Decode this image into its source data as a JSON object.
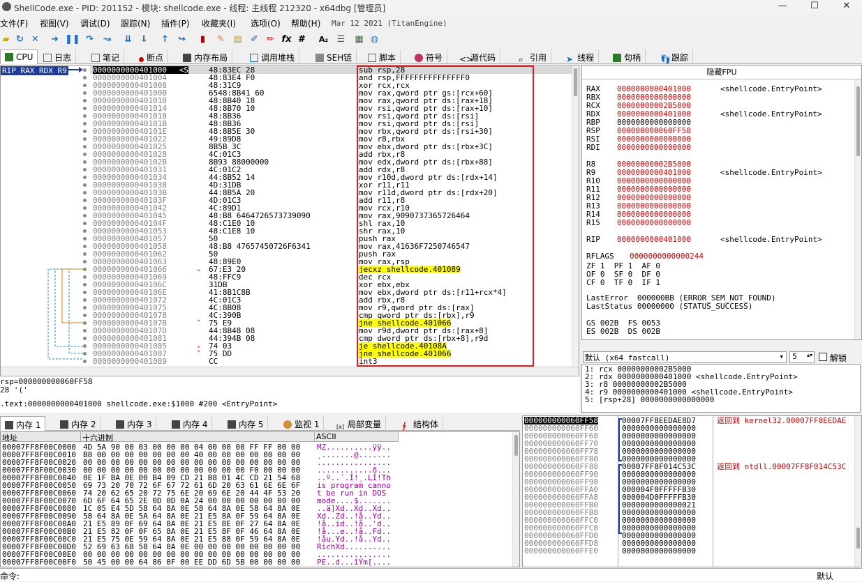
{
  "title": "ShellCode.exe - PID: 201152 - 模块: shellcode.exe - 线程: 主线程 212320 - x64dbg [管理员]",
  "window_controls": [
    "—",
    "☐",
    "✕"
  ],
  "menus": [
    "文件(F)",
    "视图(V)",
    "调试(D)",
    "跟踪(N)",
    "插件(P)",
    "收藏夹(I)",
    "选项(O)",
    "帮助(H)"
  ],
  "build_info": "Mar 12 2021 (TitanEngine)",
  "toolbar_icons": [
    "open-icon",
    "restart-icon",
    "close-icon",
    "run-icon",
    "pause-icon",
    "step-into-icon",
    "step-over-icon",
    "trace-into-icon",
    "trace-over-icon",
    "execute-till-return-icon",
    "run-to-user-code-icon",
    "bookmark-icon",
    "comment-icon",
    "label-icon",
    "patch-icon",
    "highlight-icon",
    "function-icon",
    "hash-icon",
    "font-icon",
    "list-icon",
    "calculator-icon",
    "globe-icon"
  ],
  "tabs": [
    {
      "label": "CPU",
      "icon": "cpu-icon",
      "active": true
    },
    {
      "label": "日志",
      "icon": "log-icon"
    },
    {
      "label": "笔记",
      "icon": "notes-icon"
    },
    {
      "label": "断点",
      "icon": "breakpoint-icon"
    },
    {
      "label": "内存布局",
      "icon": "memory-map-icon"
    },
    {
      "label": "调用堆栈",
      "icon": "callstack-icon"
    },
    {
      "label": "SEH链",
      "icon": "seh-icon"
    },
    {
      "label": "脚本",
      "icon": "script-icon"
    },
    {
      "label": "符号",
      "icon": "symbols-icon"
    },
    {
      "label": "源代码",
      "icon": "source-icon"
    },
    {
      "label": "引用",
      "icon": "references-icon"
    },
    {
      "label": "线程",
      "icon": "threads-icon"
    },
    {
      "label": "句柄",
      "icon": "handles-icon"
    },
    {
      "label": "跟踪",
      "icon": "trace-icon"
    }
  ],
  "reg_tag": "RIP RAX RDX R9",
  "disasm": [
    {
      "addr": "0000000000401000",
      "bytes": "48:83EC 28",
      "instr": "sub rsp,28",
      "selected": true,
      "addr_suffix": " <S"
    },
    {
      "addr": "0000000000401004",
      "bytes": "48:83E4 F0",
      "instr": "and rsp,FFFFFFFFFFFFFFF0"
    },
    {
      "addr": "0000000000401008",
      "bytes": "48:31C9",
      "instr": "xor rcx,rcx"
    },
    {
      "addr": "000000000040100B",
      "bytes": "6548:8B41 60",
      "instr": "mov rax,qword ptr gs:[rcx+60]"
    },
    {
      "addr": "0000000000401010",
      "bytes": "48:8B40 18",
      "instr": "mov rax,qword ptr ds:[rax+18]"
    },
    {
      "addr": "0000000000401014",
      "bytes": "48:8B70 10",
      "instr": "mov rsi,qword ptr ds:[rax+10]"
    },
    {
      "addr": "0000000000401018",
      "bytes": "48:8B36",
      "instr": "mov rsi,qword ptr ds:[rsi]"
    },
    {
      "addr": "000000000040101B",
      "bytes": "48:8B36",
      "instr": "mov rsi,qword ptr ds:[rsi]"
    },
    {
      "addr": "000000000040101E",
      "bytes": "48:8B5E 30",
      "instr": "mov rbx,qword ptr ds:[rsi+30]"
    },
    {
      "addr": "0000000000401022",
      "bytes": "49:89D8",
      "instr": "mov r8,rbx"
    },
    {
      "addr": "0000000000401025",
      "bytes": "8B5B 3C",
      "instr": "mov ebx,dword ptr ds:[rbx+3C]"
    },
    {
      "addr": "0000000000401028",
      "bytes": "4C:01C3",
      "instr": "add rbx,r8"
    },
    {
      "addr": "000000000040102B",
      "bytes": "8B93 88000000",
      "instr": "mov edx,dword ptr ds:[rbx+88]"
    },
    {
      "addr": "0000000000401031",
      "bytes": "4C:01C2",
      "instr": "add rdx,r8"
    },
    {
      "addr": "0000000000401034",
      "bytes": "44:8B52 14",
      "instr": "mov r10d,dword ptr ds:[rdx+14]"
    },
    {
      "addr": "0000000000401038",
      "bytes": "4D:31DB",
      "instr": "xor r11,r11"
    },
    {
      "addr": "000000000040103B",
      "bytes": "44:8B5A 20",
      "instr": "mov r11d,dword ptr ds:[rdx+20]"
    },
    {
      "addr": "000000000040103F",
      "bytes": "4D:01C3",
      "instr": "add r11,r8"
    },
    {
      "addr": "0000000000401042",
      "bytes": "4C:89D1",
      "instr": "mov rcx,r10"
    },
    {
      "addr": "0000000000401045",
      "bytes": "48:B8 6464726573739090",
      "instr": "mov rax,9090737365726464"
    },
    {
      "addr": "000000000040104F",
      "bytes": "48:C1E0 10",
      "instr": "shl rax,10"
    },
    {
      "addr": "0000000000401053",
      "bytes": "48:C1E8 10",
      "instr": "shr rax,10"
    },
    {
      "addr": "0000000000401057",
      "bytes": "50",
      "instr": "push rax"
    },
    {
      "addr": "0000000000401058",
      "bytes": "48:B8 47657450726F6341",
      "instr": "mov rax,41636F7250746547"
    },
    {
      "addr": "0000000000401062",
      "bytes": "50",
      "instr": "push rax"
    },
    {
      "addr": "0000000000401063",
      "bytes": "48:89E0",
      "instr": "mov rax,rsp"
    },
    {
      "addr": "0000000000401066",
      "bytes": "67:E3 20",
      "instr": "jecxz shellcode.401089",
      "jump": true,
      "arrow": "v"
    },
    {
      "addr": "0000000000401069",
      "bytes": "48:FFC9",
      "instr": "dec rcx"
    },
    {
      "addr": "000000000040106C",
      "bytes": "31DB",
      "instr": "xor ebx,ebx"
    },
    {
      "addr": "000000000040106E",
      "bytes": "41:8B1C8B",
      "instr": "mov ebx,dword ptr ds:[r11+rcx*4]"
    },
    {
      "addr": "0000000000401072",
      "bytes": "4C:01C3",
      "instr": "add rbx,r8"
    },
    {
      "addr": "0000000000401075",
      "bytes": "4C:8B08",
      "instr": "mov r9,qword ptr ds:[rax]"
    },
    {
      "addr": "0000000000401078",
      "bytes": "4C:390B",
      "instr": "cmp qword ptr ds:[rbx],r9"
    },
    {
      "addr": "000000000040107B",
      "bytes": "75 E9",
      "instr": "jne shellcode.401066",
      "jump": true,
      "arrow": "^"
    },
    {
      "addr": "000000000040107D",
      "bytes": "44:8B48 08",
      "instr": "mov r9d,dword ptr ds:[rax+8]"
    },
    {
      "addr": "0000000000401081",
      "bytes": "44:394B 08",
      "instr": "cmp dword ptr ds:[rbx+8],r9d"
    },
    {
      "addr": "0000000000401085",
      "bytes": "74 03",
      "instr": "je shellcode.40108A",
      "jump": true,
      "arrow": "v"
    },
    {
      "addr": "0000000000401087",
      "bytes": "75 DD",
      "instr": "jne shellcode.401066",
      "jump": true,
      "arrow": "^"
    },
    {
      "addr": "0000000000401089",
      "bytes": "CC",
      "instr": "int3"
    }
  ],
  "info_lines": [
    "rsp=000000000060FF58",
    "28 '('",
    "",
    ".text:0000000000401000 shellcode.exe:$1000 #200 <EntryPoint>"
  ],
  "fpu_header": "隐藏FPU",
  "registers": [
    {
      "name": "RAX",
      "value": "0000000000401000",
      "comment": "<shellcode.EntryPoint>",
      "red": true
    },
    {
      "name": "RBX",
      "value": "0000000000000000",
      "red": true
    },
    {
      "name": "RCX",
      "value": "00000000002B5000",
      "red": true
    },
    {
      "name": "RDX",
      "value": "0000000000401000",
      "comment": "<shellcode.EntryPoint>",
      "red": true
    },
    {
      "name": "RBP",
      "value": "0000000000000000"
    },
    {
      "name": "RSP",
      "value": "000000000060FF58",
      "red": true
    },
    {
      "name": "RSI",
      "value": "0000000000000000",
      "red": true
    },
    {
      "name": "RDI",
      "value": "0000000000000000",
      "red": true
    },
    {
      "name": "",
      "value": ""
    },
    {
      "name": "R8",
      "value": "00000000002B5000",
      "red": true
    },
    {
      "name": "R9",
      "value": "0000000000401000",
      "comment": "<shellcode.EntryPoint>",
      "red": true
    },
    {
      "name": "R10",
      "value": "0000000000000000",
      "red": true
    },
    {
      "name": "R11",
      "value": "0000000000000000",
      "red": true
    },
    {
      "name": "R12",
      "value": "0000000000000000",
      "red": true
    },
    {
      "name": "R13",
      "value": "0000000000000000",
      "red": true
    },
    {
      "name": "R14",
      "value": "0000000000000000",
      "red": true
    },
    {
      "name": "R15",
      "value": "0000000000000000",
      "red": true
    },
    {
      "name": "",
      "value": ""
    },
    {
      "name": "RIP",
      "value": "0000000000401000",
      "comment": "<shellcode.EntryPoint>",
      "red": true
    }
  ],
  "rflags": {
    "label": "RFLAGS",
    "value": "0000000000000244"
  },
  "flags_rows": [
    "ZF 1  PF 1  AF 0",
    "OF 0  SF 0  DF 0",
    "CF 0  TF 0  IF 1"
  ],
  "last_error": "LastError  000000BB (ERROR_SEM_NOT_FOUND)",
  "last_status": "LastStatus 00000000 (STATUS_SUCCESS)",
  "segs": [
    "GS 002B  FS 0053",
    "ES 002B  DS 002B"
  ],
  "callconv": {
    "value": "默认 (x64 fastcall)",
    "count": "5",
    "unlock_label": "解锁"
  },
  "stack_args": [
    "1: rcx 00000000002B5000",
    "2: rdx 0000000000401000 <shellcode.EntryPoint>",
    "3: r8 00000000002B5000",
    "4: r9 0000000000401000 <shellcode.EntryPoint>",
    "5: [rsp+28] 0000000000000000"
  ],
  "dump_tabs": [
    {
      "label": "内存 1",
      "active": true
    },
    {
      "label": "内存 2"
    },
    {
      "label": "内存 3"
    },
    {
      "label": "内存 4"
    },
    {
      "label": "内存 5"
    },
    {
      "label": "监视 1"
    },
    {
      "label": "局部变量"
    },
    {
      "label": "结构体"
    }
  ],
  "dump_headers": {
    "addr": "地址",
    "hex": "十六进制",
    "ascii": "ASCII"
  },
  "dump_rows": [
    {
      "addr": "00007FF8F00C0000",
      "hex": "4D 5A 90 00 03 00 00 00 04 00 00 00 FF FF 00 00",
      "ascii": "MZ..........ÿÿ.."
    },
    {
      "addr": "00007FF8F00C0010",
      "hex": "B8 00 00 00 00 00 00 00 40 00 00 00 00 00 00 00",
      "ascii": "¸.......@......."
    },
    {
      "addr": "00007FF8F00C0020",
      "hex": "00 00 00 00 00 00 00 00 00 00 00 00 00 00 00 00",
      "ascii": "................"
    },
    {
      "addr": "00007FF8F00C0030",
      "hex": "00 00 00 00 00 00 00 00 00 00 00 00 F0 00 00 00",
      "ascii": "............ð..."
    },
    {
      "addr": "00007FF8F00C0040",
      "hex": "0E 1F BA 0E 00 B4 09 CD 21 B8 01 4C CD 21 54 68",
      "ascii": "..º..´.Í!¸.LÍ!Th"
    },
    {
      "addr": "00007FF8F00C0050",
      "hex": "69 73 20 70 72 6F 67 72 61 6D 20 63 61 6E 6E 6F",
      "ascii": "is program canno"
    },
    {
      "addr": "00007FF8F00C0060",
      "hex": "74 20 62 65 20 72 75 6E 20 69 6E 20 44 4F 53 20",
      "ascii": "t be run in DOS "
    },
    {
      "addr": "00007FF8F00C0070",
      "hex": "6D 6F 64 65 2E 0D 0D 0A 24 00 00 00 00 00 00 00",
      "ascii": "mode....$......."
    },
    {
      "addr": "00007FF8F00C0080",
      "hex": "1C 05 E4 5D 58 64 8A 0E 58 64 8A 0E 58 64 8A 0E",
      "ascii": "..ä]Xd..Xd..Xd.."
    },
    {
      "addr": "00007FF8F00C0090",
      "hex": "58 64 8A 0E 5A 64 8A 0E 21 E5 8A 0F 59 64 8A 0E",
      "ascii": "Xd..Zd..!å..Yd.."
    },
    {
      "addr": "00007FF8F00C00A0",
      "hex": "21 E5 89 0F 69 64 8A 0E 21 E5 8E 0F 27 64 8A 0E",
      "ascii": "!å..id..!å..'d.."
    },
    {
      "addr": "00007FF8F00C00B0",
      "hex": "21 E5 82 0F 0F 65 8A 0E 21 E5 8F 0F 46 64 8A 0E",
      "ascii": "!å...e..!å..Fd.."
    },
    {
      "addr": "00007FF8F00C00C0",
      "hex": "21 E5 75 0E 59 64 8A 0E 21 E5 88 0F 59 64 8A 0E",
      "ascii": "!åu.Yd..!å..Yd.."
    },
    {
      "addr": "00007FF8F00C00D0",
      "hex": "52 69 63 68 58 64 8A 0E 00 00 00 00 00 00 00 00",
      "ascii": "RichXd.........."
    },
    {
      "addr": "00007FF8F00C00E0",
      "hex": "00 00 00 00 00 00 00 00 00 00 00 00 00 00 00 00",
      "ascii": "................"
    },
    {
      "addr": "00007FF8F00C00F0",
      "hex": "50 45 00 00 64 86 0F 00 EE DD 6D 5B 00 00 00 00",
      "ascii": "PE..d...îÝm[...."
    }
  ],
  "stack_rows": [
    {
      "addr": "000000000060FF58",
      "value": "00007FF8EEDAE8D7",
      "comment": "返回到 kernel32.00007FF8EEDAE",
      "selected": true
    },
    {
      "addr": "000000000060FF60",
      "value": "0000000000000000"
    },
    {
      "addr": "000000000060FF68",
      "value": "0000000000000000"
    },
    {
      "addr": "000000000060FF70",
      "value": "0000000000000000"
    },
    {
      "addr": "000000000060FF78",
      "value": "0000000000000000"
    },
    {
      "addr": "000000000060FF80",
      "value": "0000000000000000"
    },
    {
      "addr": "000000000060FF88",
      "value": "00007FF8F014C53C",
      "comment": "返回到 ntdll.00007FF8F014C53C"
    },
    {
      "addr": "000000000060FF90",
      "value": "0000000000000000"
    },
    {
      "addr": "000000000060FF98",
      "value": "0000000000000000"
    },
    {
      "addr": "000000000060FFA0",
      "value": "000004F0FFFFFB30"
    },
    {
      "addr": "000000000060FFA8",
      "value": "000004D0FFFFFB30"
    },
    {
      "addr": "000000000060FFB0",
      "value": "0000000000000021"
    },
    {
      "addr": "000000000060FFB8",
      "value": "0000000000000000"
    },
    {
      "addr": "000000000060FFC0",
      "value": "0000000000000000"
    },
    {
      "addr": "000000000060FFC8",
      "value": "0000000000000000"
    },
    {
      "addr": "000000000060FFD0",
      "value": "0000000000000000"
    },
    {
      "addr": "000000000060FFD8",
      "value": "0000000000000000"
    },
    {
      "addr": "000000000060FFE0",
      "value": "0000000000000000"
    }
  ],
  "cmd_label": "命令:",
  "cmd_right": "默认"
}
